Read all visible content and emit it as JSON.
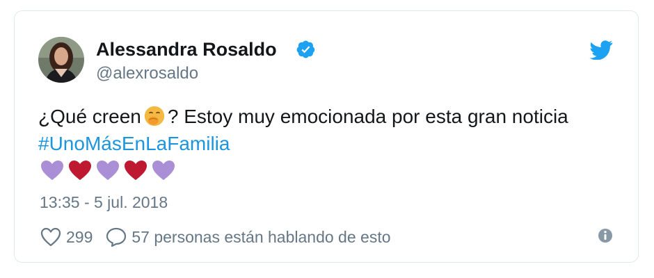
{
  "tweet": {
    "author_name": "Alessandra Rosaldo",
    "handle": "@alexrosaldo",
    "text_before_emoji": "¿Qué creen",
    "text_after_emoji": "? Estoy muy emocionada por esta gran noticia",
    "hashtag": "#UnoMásEnLaFamilia",
    "hearts": [
      "purple",
      "red",
      "purple",
      "red",
      "purple"
    ],
    "timestamp": "13:35 - 5 jul. 2018",
    "like_count": "299",
    "reply_label": "57 personas están hablando de esto"
  },
  "icons": {
    "verified": "verified-badge-icon",
    "bird": "twitter-bird-icon",
    "like": "heart-outline-icon",
    "reply": "speech-bubble-icon",
    "info": "info-icon",
    "emoji": "face-with-hand-over-mouth-emoji"
  },
  "colors": {
    "accent": "#1da1f2",
    "link": "#1b95e0",
    "heart_purple": "#aa8ed6",
    "heart_red": "#be1931",
    "muted": "#657786",
    "border": "#e1e8ed"
  }
}
